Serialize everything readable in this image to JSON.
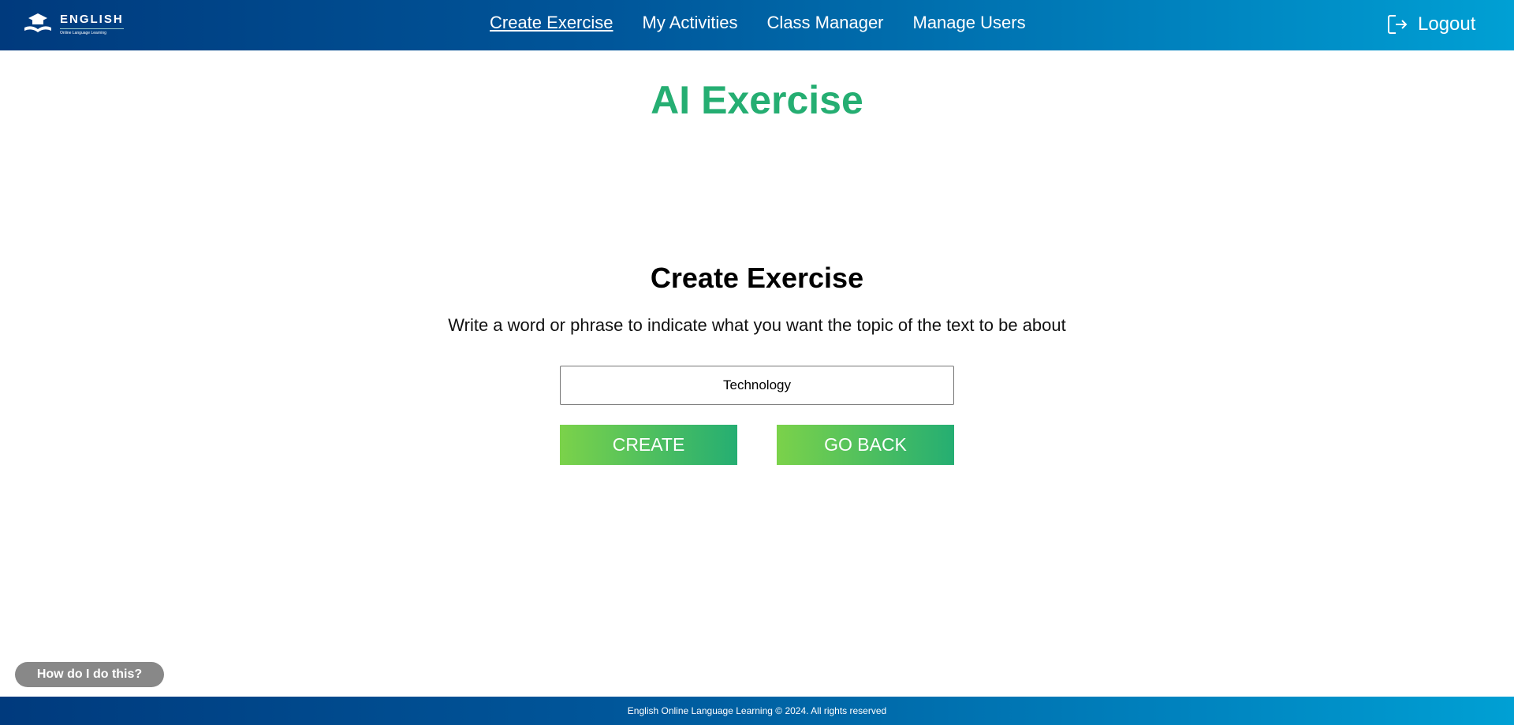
{
  "header": {
    "logo": {
      "title": "ENGLISH",
      "subtitle": "Online Language Learning"
    },
    "nav": [
      {
        "label": "Create Exercise",
        "active": true
      },
      {
        "label": "My Activities"
      },
      {
        "label": "Class Manager"
      },
      {
        "label": "Manage Users"
      }
    ],
    "logout_label": "Logout"
  },
  "main": {
    "page_title": "AI Exercise",
    "heading": "Create Exercise",
    "instructions": "Write a word or phrase to indicate what you want the topic of the text to be about",
    "topic_value": "Technology",
    "create_label": "CREATE",
    "go_back_label": "GO BACK"
  },
  "help_label": "How do I do this?",
  "footer": {
    "text": "English Online Language Learning © 2024. All rights reserved"
  },
  "colors": {
    "accent": "#25ae72",
    "gradient_start": "#7bd24a",
    "header_dark": "#003a7d",
    "header_light": "#00a0d4"
  }
}
